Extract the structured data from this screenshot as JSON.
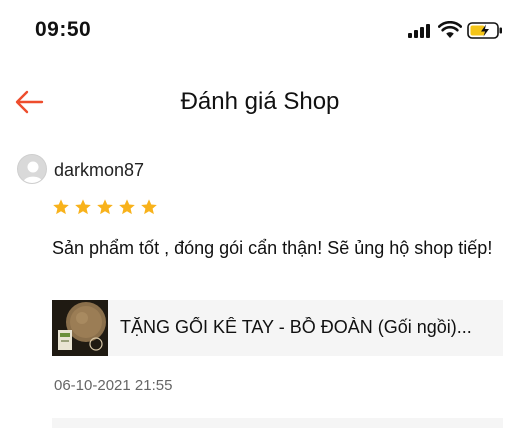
{
  "status_bar": {
    "time": "09:50"
  },
  "header": {
    "title": "Đánh giá Shop",
    "back_icon": "arrow-left-icon"
  },
  "colors": {
    "accent": "#ee4d2d",
    "star": "#f8b21b",
    "battery_charge": "#f5c518"
  },
  "review": {
    "username": "darkmon87",
    "rating": 5,
    "rating_max": 5,
    "text": "Sản phẩm tốt , đóng gói cẩn thận! Sẽ ủng hộ shop tiếp!",
    "product": {
      "name": "TẶNG GỐI KÊ TAY - BỒ ĐOÀN (Gối ngồi)..."
    },
    "date": "06-10-2021 21:55"
  }
}
